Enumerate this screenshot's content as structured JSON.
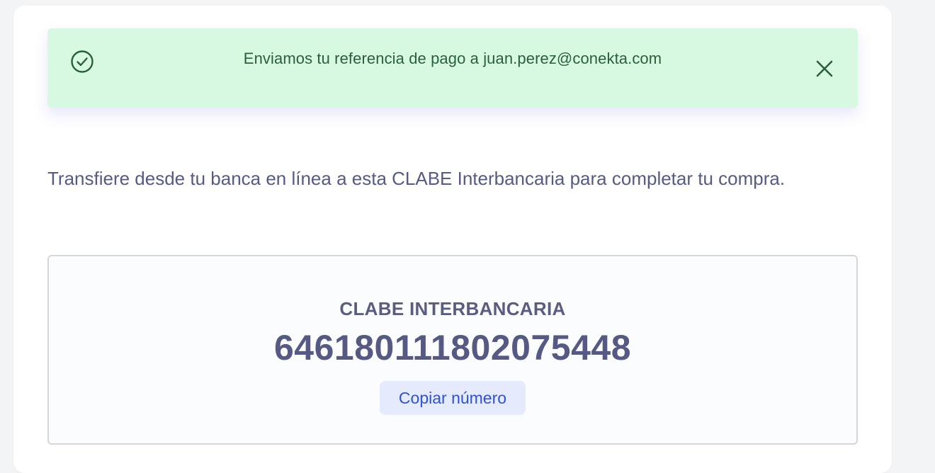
{
  "alert": {
    "message": "Enviamos tu referencia de pago a juan.perez@conekta.com",
    "icon": "check-circle-icon",
    "close_icon": "close-icon",
    "color_background": "#d8f9e1",
    "color_text": "#2a5f3b"
  },
  "instructions": {
    "text": "Transfiere desde tu banca en línea a esta CLABE Interbancaria para completar tu compra."
  },
  "clabe": {
    "label": "CLABE INTERBANCARIA",
    "number": "646180111802075448",
    "copy_label": "Copiar número"
  }
}
